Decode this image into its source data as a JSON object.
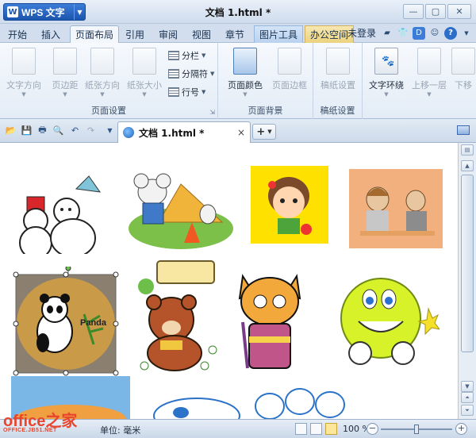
{
  "titlebar": {
    "app_name": "WPS 文字",
    "app_logo": "W",
    "doc_title": "文档 1.html *",
    "window_buttons": {
      "minimize": "—",
      "restore": "▢",
      "close": "✕"
    }
  },
  "menu_tabs": [
    {
      "label": "开始"
    },
    {
      "label": "插入"
    },
    {
      "label": "页面布局",
      "active": true
    },
    {
      "label": "引用"
    },
    {
      "label": "审阅"
    },
    {
      "label": "视图"
    },
    {
      "label": "章节"
    },
    {
      "label": "图片工具",
      "contextual": "blue"
    },
    {
      "label": "办公空间",
      "contextual": "gold"
    }
  ],
  "account": {
    "login_label": "未登录",
    "help": "?"
  },
  "ribbon": {
    "page_setup": {
      "label": "页面设置",
      "text_direction": "文字方向",
      "margins": "页边距",
      "orientation": "纸张方向",
      "size": "纸张大小",
      "columns": "分栏",
      "breaks": "分隔符",
      "line_numbers": "行号"
    },
    "page_background": {
      "label": "页面背景",
      "page_color": "页面颜色",
      "page_border": "页面边框"
    },
    "manuscript": {
      "label": "稿纸设置",
      "manuscript_setup": "稿纸设置"
    },
    "arrange": {
      "text_wrap": "文字环绕",
      "bring_forward": "上移一层",
      "send_backward": "下移"
    }
  },
  "doc_tab": {
    "name": "文档 1.html *",
    "close": "×",
    "new": "+"
  },
  "canvas": {
    "panda_text": "Panda"
  },
  "statusbar": {
    "unit_label": "单位: 毫米",
    "zoom": "100 %",
    "zoom_fraction": 0.5
  },
  "watermark": {
    "main": "office之家",
    "sub": "OFFICE.JB51.NET"
  },
  "colors": {
    "accent": "#1c55ad",
    "ribbon_bg": "#eef3f9",
    "watermark": "#e8452c"
  }
}
